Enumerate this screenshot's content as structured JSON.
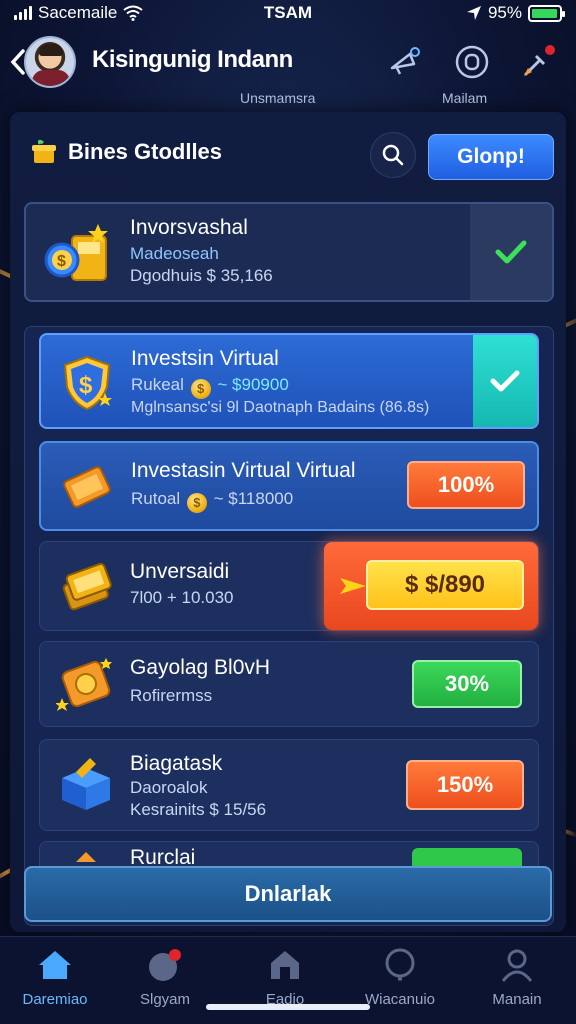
{
  "status_bar": {
    "carrier": "Sacemaile",
    "time": "TSAM",
    "battery": "95%",
    "battery_level": 0.95
  },
  "header": {
    "title": "Kisingunig Indann",
    "sub_label_1": "Unsmamsra",
    "sub_label_2": "Mailam"
  },
  "panel": {
    "title": "Bines Gtodlles",
    "primary_button": "Glonp!",
    "summary": {
      "title": "Invorsvashal",
      "subtitle": "Madeoseah",
      "detail": "Dgodhuis $ 35,166"
    },
    "items": [
      {
        "title": "Investsin Virtual",
        "line2_prefix": "Rukeal",
        "line2_value": "~ $90900",
        "line3": "Mglnsansc'si 9l Daotnaph Badains (86.8s)",
        "status": "check"
      },
      {
        "title": "Investasin Virtual Virtual",
        "line2_prefix": "Rutoal",
        "line2_value": "~ $118000",
        "badge": "100%"
      },
      {
        "title": "Unversaidi",
        "line2": "7l00 + 10.030",
        "badge": "$ $/890"
      },
      {
        "title": "Gayolag Bl0vH",
        "line2": "Rofirermss",
        "badge": "30%"
      },
      {
        "title": "Biagatask",
        "line2": "Daoroalok",
        "line3": "Kesrainits $ 15/56",
        "badge": "150%"
      },
      {
        "title": "Rurclai"
      }
    ],
    "bottom_button": "Dnlarlak"
  },
  "tabbar": {
    "tabs": [
      {
        "label": "Daremiao",
        "icon": "home-icon",
        "active": true
      },
      {
        "label": "Slgyam",
        "icon": "chat-icon",
        "active": false
      },
      {
        "label": "Eadio",
        "icon": "store-icon",
        "active": false
      },
      {
        "label": "Wiacanuio",
        "icon": "search-icon",
        "active": false
      },
      {
        "label": "Manain",
        "icon": "profile-icon",
        "active": false
      }
    ]
  },
  "colors": {
    "accent_blue": "#2f7bff",
    "orange_badge": "#ff6a2a",
    "green_badge": "#2fc84a",
    "yellow_badge": "#ffd31a",
    "teal_check": "#21d3c8"
  }
}
